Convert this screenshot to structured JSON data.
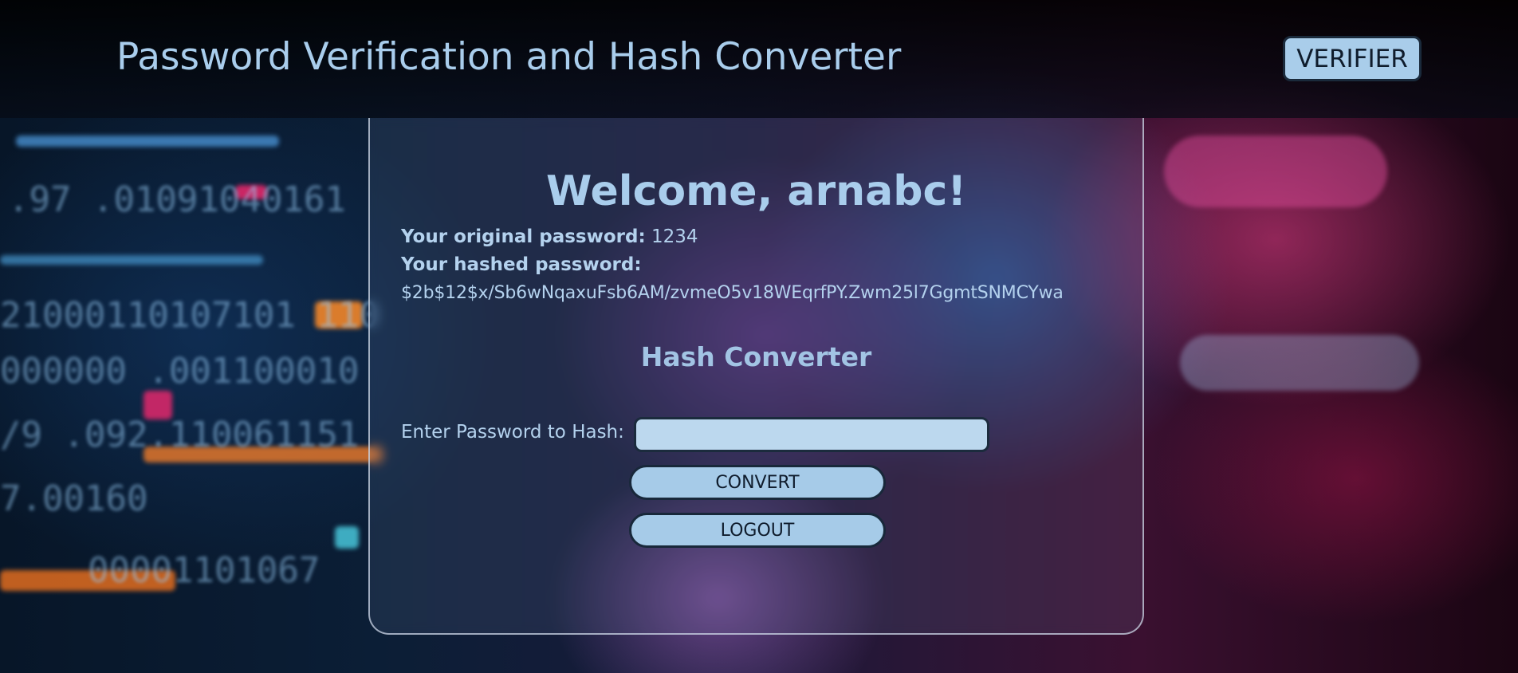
{
  "header": {
    "title": "Password Verification and Hash Converter",
    "verifier_label": "VERIFIER"
  },
  "main": {
    "welcome": "Welcome, arnabc!",
    "original_password_label": "Your original password:",
    "original_password_value": "1234",
    "hashed_password_label": "Your hashed password:",
    "hashed_password_value": "$2b$12$x/Sb6wNqaxuFsb6AM/zvmeO5v18WEqrfPY.Zwm25l7GgmtSNMCYwa",
    "section_title": "Hash Converter",
    "hash_input_label": "Enter Password to Hash:",
    "hash_input_value": "",
    "convert_label": "CONVERT",
    "logout_label": "LOGOUT"
  },
  "colors": {
    "accent": "#a9cdec",
    "button_fill": "#a6cbe8",
    "button_border": "#18283a"
  }
}
